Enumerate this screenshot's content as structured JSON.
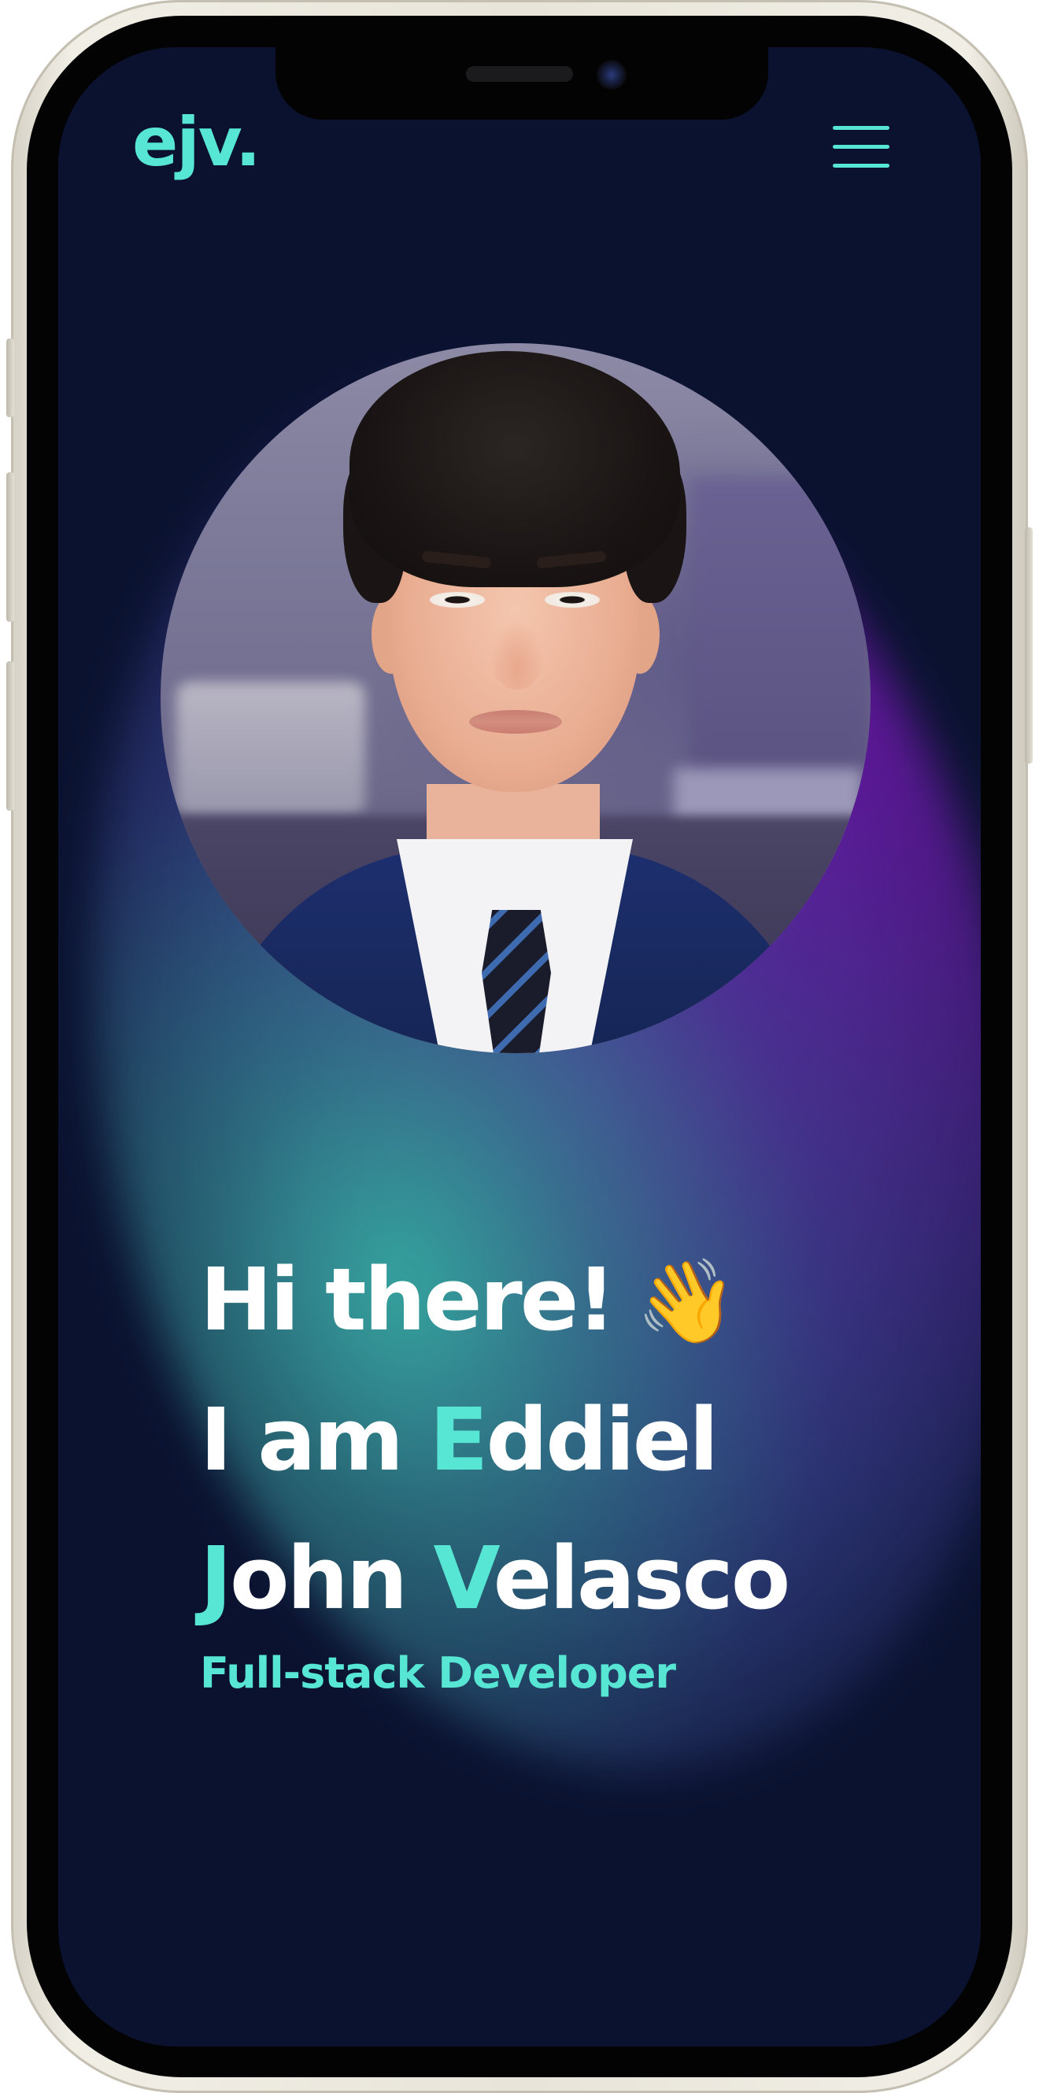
{
  "nav": {
    "logo": "ejv.",
    "menu_icon": "hamburger-menu-icon"
  },
  "hero": {
    "greeting": "Hi there!",
    "greeting_emoji": "👋",
    "intro_prefix": "I am ",
    "first_initial": "E",
    "first_rest": "ddiel",
    "middle_name": "John ",
    "last_initial": "V",
    "last_rest": "elasco",
    "subtitle": "Full-stack Developer"
  },
  "profile_photo": {
    "subject": "portrait photo"
  },
  "theme": {
    "background": "#0a1230",
    "accent": "#57e6d3",
    "text": "#ffffff",
    "glow_teal": "#36aaa0",
    "glow_purple": "#6e14aa"
  }
}
